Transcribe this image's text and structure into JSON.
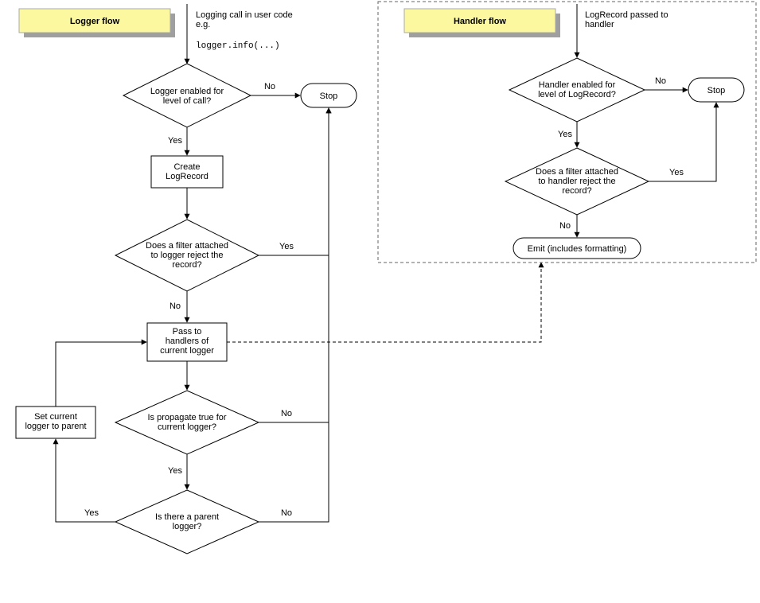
{
  "titles": {
    "logger": "Logger flow",
    "handler": "Handler flow"
  },
  "logger": {
    "start": "Logging call in user code\ne.g.",
    "start_code": "logger.info(...)",
    "d1": "Logger enabled for\nlevel of call?",
    "stop": "Stop",
    "p1": "Create\nLogRecord",
    "d2": "Does a filter attached\nto logger reject the\nrecord?",
    "p2": "Pass to\nhandlers of\ncurrent logger",
    "d3": "Is propagate true for\ncurrent logger?",
    "d4": "Is there a parent\nlogger?",
    "p3": "Set current\nlogger to parent",
    "yes": "Yes",
    "no": "No"
  },
  "handler": {
    "start": "LogRecord passed to\nhandler",
    "d1": "Handler enabled for\nlevel of LogRecord?",
    "stop": "Stop",
    "d2": "Does a filter attached\nto handler reject the\nrecord?",
    "emit": "Emit (includes formatting)",
    "yes": "Yes",
    "no": "No"
  }
}
